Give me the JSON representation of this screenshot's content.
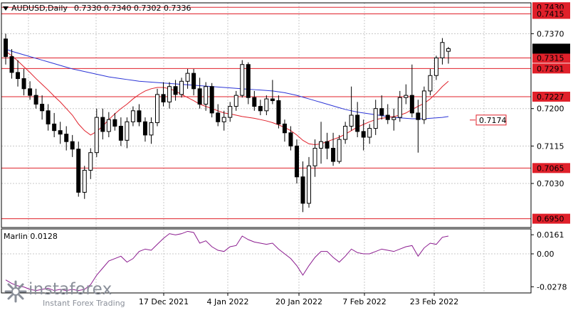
{
  "header": {
    "symbol": "AUDUSD,Daily",
    "ohlc": "0.7330 0.7340 0.7302 0.7336",
    "indicator_label": "Marlin 0.0128"
  },
  "brand": {
    "name": "instaforex",
    "tagline": "Instant Forex Trading"
  },
  "colors": {
    "bull": "#ffffff",
    "bear": "#000000",
    "ma_red": "#e0202a",
    "ma_blue": "#2b34d6",
    "level_red": "#e0202a",
    "osc": "#8b1b8f",
    "price_box": "#000000"
  },
  "chart_data": [
    {
      "type": "candlestick",
      "symbol": "AUDUSD",
      "timeframe": "Daily",
      "ylim": [
        0.693,
        0.744
      ],
      "y_ticks": [
        "0.7370",
        "0.7200",
        "0.7115",
        "0.7030"
      ],
      "x_ticks": [
        "17 Dec 2021",
        "4 Jan 2022",
        "20 Jan 2022",
        "7 Feb 2022",
        "23 Feb 2022"
      ],
      "current_price": "0.7336",
      "levels": [
        {
          "label": "0.7430",
          "value": 0.743
        },
        {
          "label": "0.7415",
          "value": 0.7415
        },
        {
          "label": "0.7315",
          "value": 0.7315
        },
        {
          "label": "0.7291",
          "value": 0.7291
        },
        {
          "label": "0.7227",
          "value": 0.7227
        },
        {
          "label": "0.7065",
          "value": 0.7065
        },
        {
          "label": "0.6950",
          "value": 0.695
        }
      ],
      "target_label": {
        "label": "0.7174",
        "value": 0.7174
      },
      "candles": [
        [
          0.7358,
          0.737,
          0.73,
          0.7318
        ],
        [
          0.7318,
          0.7335,
          0.7268,
          0.7282
        ],
        [
          0.7282,
          0.731,
          0.725,
          0.7268
        ],
        [
          0.7268,
          0.729,
          0.723,
          0.7245
        ],
        [
          0.7245,
          0.7262,
          0.722,
          0.723
        ],
        [
          0.723,
          0.7245,
          0.72,
          0.721
        ],
        [
          0.721,
          0.723,
          0.7175,
          0.7195
        ],
        [
          0.7195,
          0.721,
          0.715,
          0.7165
        ],
        [
          0.7165,
          0.719,
          0.7135,
          0.715
        ],
        [
          0.715,
          0.717,
          0.712,
          0.7142
        ],
        [
          0.7142,
          0.716,
          0.7105,
          0.7125
        ],
        [
          0.7125,
          0.714,
          0.709,
          0.7108
        ],
        [
          0.7108,
          0.7125,
          0.7,
          0.701
        ],
        [
          0.701,
          0.707,
          0.6995,
          0.706
        ],
        [
          0.706,
          0.711,
          0.704,
          0.71
        ],
        [
          0.71,
          0.72,
          0.709,
          0.718
        ],
        [
          0.718,
          0.72,
          0.713,
          0.7148
        ],
        [
          0.7148,
          0.7192,
          0.7135,
          0.7175
        ],
        [
          0.7175,
          0.719,
          0.715,
          0.716
        ],
        [
          0.716,
          0.718,
          0.7115,
          0.7128
        ],
        [
          0.7128,
          0.718,
          0.711,
          0.717
        ],
        [
          0.717,
          0.7205,
          0.716,
          0.7195
        ],
        [
          0.7195,
          0.721,
          0.716,
          0.717
        ],
        [
          0.717,
          0.718,
          0.7125,
          0.714
        ],
        [
          0.714,
          0.718,
          0.712,
          0.7168
        ],
        [
          0.7168,
          0.7245,
          0.716,
          0.7232
        ],
        [
          0.7232,
          0.726,
          0.7205,
          0.7215
        ],
        [
          0.7215,
          0.726,
          0.72,
          0.725
        ],
        [
          0.725,
          0.7265,
          0.7218,
          0.7232
        ],
        [
          0.7232,
          0.727,
          0.7225,
          0.7262
        ],
        [
          0.7262,
          0.729,
          0.7245,
          0.728
        ],
        [
          0.728,
          0.729,
          0.723,
          0.7245
        ],
        [
          0.7245,
          0.727,
          0.72,
          0.721
        ],
        [
          0.721,
          0.726,
          0.7195,
          0.725
        ],
        [
          0.725,
          0.7258,
          0.718,
          0.719
        ],
        [
          0.719,
          0.721,
          0.716,
          0.717
        ],
        [
          0.717,
          0.7195,
          0.715,
          0.718
        ],
        [
          0.718,
          0.7215,
          0.717,
          0.7205
        ],
        [
          0.7205,
          0.724,
          0.7195,
          0.723
        ],
        [
          0.723,
          0.731,
          0.7225,
          0.73
        ],
        [
          0.73,
          0.7305,
          0.721,
          0.7225
        ],
        [
          0.7225,
          0.724,
          0.7195,
          0.7205
        ],
        [
          0.7205,
          0.722,
          0.7185,
          0.7195
        ],
        [
          0.7195,
          0.723,
          0.7185,
          0.7222
        ],
        [
          0.7222,
          0.7265,
          0.721,
          0.7218
        ],
        [
          0.7218,
          0.723,
          0.7155,
          0.7165
        ],
        [
          0.7165,
          0.7175,
          0.7125,
          0.7145
        ],
        [
          0.7145,
          0.716,
          0.7105,
          0.7115
        ],
        [
          0.7115,
          0.713,
          0.703,
          0.7045
        ],
        [
          0.7045,
          0.708,
          0.6965,
          0.6985
        ],
        [
          0.6985,
          0.709,
          0.6975,
          0.707
        ],
        [
          0.707,
          0.713,
          0.7045,
          0.711
        ],
        [
          0.711,
          0.717,
          0.7075,
          0.7125
        ],
        [
          0.7125,
          0.7145,
          0.7085,
          0.711
        ],
        [
          0.711,
          0.7145,
          0.707,
          0.708
        ],
        [
          0.708,
          0.714,
          0.7075,
          0.713
        ],
        [
          0.713,
          0.717,
          0.712,
          0.716
        ],
        [
          0.716,
          0.725,
          0.715,
          0.7185
        ],
        [
          0.7185,
          0.7215,
          0.7135,
          0.7148
        ],
        [
          0.7148,
          0.7175,
          0.7105,
          0.7135
        ],
        [
          0.7135,
          0.7165,
          0.712,
          0.7155
        ],
        [
          0.7155,
          0.722,
          0.714,
          0.72
        ],
        [
          0.72,
          0.723,
          0.7175,
          0.7185
        ],
        [
          0.7185,
          0.721,
          0.7165,
          0.7175
        ],
        [
          0.7175,
          0.72,
          0.715,
          0.718
        ],
        [
          0.718,
          0.724,
          0.717,
          0.7225
        ],
        [
          0.7225,
          0.7255,
          0.721,
          0.723
        ],
        [
          0.723,
          0.73,
          0.718,
          0.719
        ],
        [
          0.719,
          0.722,
          0.71,
          0.7175
        ],
        [
          0.7175,
          0.725,
          0.7165,
          0.724
        ],
        [
          0.724,
          0.729,
          0.723,
          0.7275
        ],
        [
          0.7275,
          0.732,
          0.7265,
          0.7315
        ],
        [
          0.7315,
          0.736,
          0.73,
          0.735
        ],
        [
          0.733,
          0.734,
          0.7302,
          0.7336
        ]
      ],
      "ma_red": [
        0.733,
        0.732,
        0.7308,
        0.7295,
        0.7282,
        0.7268,
        0.7255,
        0.7242,
        0.7228,
        0.7215,
        0.72,
        0.7185,
        0.7165,
        0.715,
        0.714,
        0.7148,
        0.716,
        0.7175,
        0.7188,
        0.72,
        0.721,
        0.7222,
        0.7232,
        0.724,
        0.7245,
        0.7248,
        0.7248,
        0.7245,
        0.724,
        0.7232,
        0.7225,
        0.7218,
        0.721,
        0.7205,
        0.72,
        0.7195,
        0.719,
        0.7188,
        0.7185,
        0.7182,
        0.718,
        0.7178,
        0.7175,
        0.7172,
        0.7168,
        0.7163,
        0.7157,
        0.715,
        0.714,
        0.7128,
        0.712,
        0.7118,
        0.712,
        0.7125,
        0.713,
        0.7135,
        0.7142,
        0.715,
        0.7158,
        0.7164,
        0.717,
        0.7175,
        0.7178,
        0.718,
        0.7182,
        0.7185,
        0.719,
        0.7198,
        0.7205,
        0.7212,
        0.7222,
        0.7235,
        0.725,
        0.7262
      ],
      "ma_blue": [
        0.7335,
        0.733,
        0.7326,
        0.7322,
        0.7318,
        0.7314,
        0.731,
        0.7306,
        0.7302,
        0.7298,
        0.7294,
        0.729,
        0.7287,
        0.7284,
        0.7281,
        0.7278,
        0.7275,
        0.7272,
        0.727,
        0.7268,
        0.7266,
        0.7264,
        0.7262,
        0.7261,
        0.726,
        0.7259,
        0.7258,
        0.7257,
        0.7256,
        0.7255,
        0.7254,
        0.7253,
        0.7252,
        0.7251,
        0.725,
        0.7249,
        0.7248,
        0.7247,
        0.7246,
        0.7245,
        0.7244,
        0.7243,
        0.7242,
        0.7241,
        0.724,
        0.7238,
        0.7236,
        0.7233,
        0.723,
        0.7226,
        0.7222,
        0.7218,
        0.7214,
        0.721,
        0.7206,
        0.7202,
        0.7198,
        0.7195,
        0.7192,
        0.719,
        0.7188,
        0.7186,
        0.7184,
        0.7182,
        0.718,
        0.7179,
        0.7178,
        0.7177,
        0.7177,
        0.7177,
        0.7178,
        0.7179,
        0.718,
        0.7182
      ]
    },
    {
      "type": "line",
      "name": "Marlin",
      "ylim": [
        -0.033,
        0.021
      ],
      "y_ticks": [
        "0.0161",
        "0.00",
        "-0.0278"
      ],
      "values": [
        -0.022,
        -0.025,
        -0.027,
        -0.028,
        -0.03,
        -0.031,
        -0.03,
        -0.029,
        -0.031,
        -0.03,
        -0.031,
        -0.03,
        -0.031,
        -0.03,
        -0.026,
        -0.018,
        -0.012,
        -0.006,
        -0.004,
        -0.002,
        -0.007,
        -0.004,
        0.002,
        0.004,
        0.003,
        0.008,
        0.013,
        0.017,
        0.016,
        0.017,
        0.019,
        0.018,
        0.009,
        0.011,
        0.006,
        0.003,
        0.002,
        0.006,
        0.007,
        0.015,
        0.012,
        0.01,
        0.009,
        0.008,
        0.009,
        0.004,
        0.0,
        -0.004,
        -0.01,
        -0.018,
        -0.01,
        -0.003,
        0.002,
        0.002,
        -0.003,
        -0.007,
        -0.002,
        0.004,
        0.001,
        0.0,
        0.0,
        0.002,
        0.004,
        0.003,
        0.002,
        0.004,
        0.006,
        0.007,
        -0.002,
        0.005,
        0.009,
        0.008,
        0.014,
        0.015
      ]
    }
  ]
}
